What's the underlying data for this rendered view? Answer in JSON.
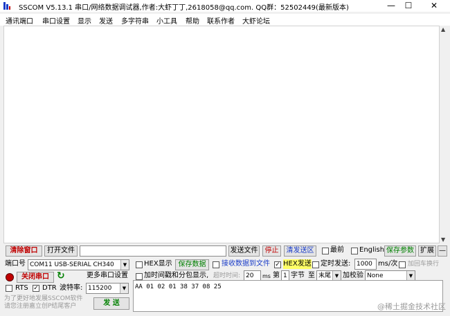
{
  "window": {
    "title": "SSCOM V5.13.1 串口/网络数据调试器,作者:大虾丁丁,2618058@qq.com. QQ群：52502449(最新版本)"
  },
  "menu": {
    "items": [
      {
        "label": "通讯端口"
      },
      {
        "label": "串口设置"
      },
      {
        "label": "显示"
      },
      {
        "label": "发送"
      },
      {
        "label": "多字符串"
      },
      {
        "label": "小工具"
      },
      {
        "label": "帮助"
      },
      {
        "label": "联系作者"
      },
      {
        "label": "大虾论坛"
      }
    ]
  },
  "toolbar": {
    "clear_window": "清除窗口",
    "open_file": "打开文件",
    "file_path": "",
    "send_file": "发送文件",
    "stop": "停止",
    "clear_send": "清发送区",
    "topmost": "最前",
    "english": "English",
    "save_params": "保存参数",
    "expand": "扩展",
    "collapse": "—"
  },
  "port": {
    "label": "端口号",
    "value": "COM11 USB-SERIAL CH340",
    "more_settings": "更多串口设置",
    "close_port": "关闭串口",
    "rts": "RTS",
    "dtr": "DTR",
    "baud_label": "波特率:",
    "baud_value": "115200"
  },
  "options": {
    "hex_display": "HEX显示",
    "save_data": "保存数据",
    "recv_to_file": "接收数据到文件",
    "hex_send": "HEX发送",
    "timed_send": "定时发送:",
    "interval": "1000",
    "interval_unit": "ms/次",
    "add_crlf": "加回车换行",
    "add_timestamp": "加时间戳和分包显示,",
    "timeout_label": "超时时间:",
    "timeout_value": "20",
    "timeout_unit": "ms",
    "nth_label": "第",
    "nth_value": "1",
    "byte_label": "字节",
    "to_label": "至",
    "end_value": "末尾",
    "checksum_label": "加校验",
    "checksum_value": "None"
  },
  "send": {
    "content": "AA 01 02 01 38 37 08 25",
    "send_button": "发 送"
  },
  "promo": {
    "line1": "为了更好地发展SSCOM软件",
    "line2": "请您注册嘉立创P结尾客户"
  },
  "watermark": "@稀土掘金技术社区"
}
